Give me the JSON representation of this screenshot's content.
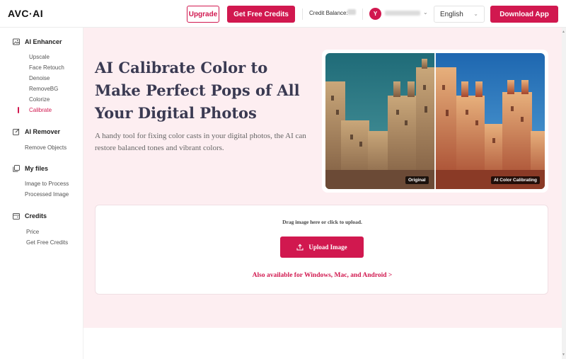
{
  "header": {
    "logo": "AVC·AI",
    "upgrade_label": "Upgrade",
    "get_credits_label": "Get Free Credits",
    "credit_balance_label": "Credit Balance:",
    "avatar_initial": "Y",
    "language": "English",
    "download_label": "Download App"
  },
  "sidebar": {
    "sections": [
      {
        "title": "AI Enhancer",
        "icon": "image-icon",
        "items": [
          "Upscale",
          "Face Retouch",
          "Denoise",
          "RemoveBG",
          "Colorize",
          "Calibrate"
        ]
      },
      {
        "title": "AI Remover",
        "icon": "edit-icon",
        "items": [
          "Remove Objects"
        ]
      },
      {
        "title": "My files",
        "icon": "files-icon",
        "items": [
          "Image to Process",
          "Processed Image"
        ]
      },
      {
        "title": "Credits",
        "icon": "wallet-icon",
        "items": [
          "Price",
          "Get Free Credits"
        ]
      }
    ],
    "active_item": "Calibrate"
  },
  "hero": {
    "title": "AI Calibrate Color to Make Perfect Pops of All Your Digital Photos",
    "description": "A handy tool for fixing color casts in your digital photos, the AI can restore balanced tones and vibrant colors.",
    "tag_before": "Original",
    "tag_after": "AI Color Calibrating"
  },
  "upload": {
    "drag_text": "Drag image here or click to upload.",
    "button_label": "Upload Image",
    "also_available": "Also available for Windows, Mac, and Android >"
  },
  "colors": {
    "accent": "#d1184f",
    "main_bg": "#fdeef1"
  }
}
